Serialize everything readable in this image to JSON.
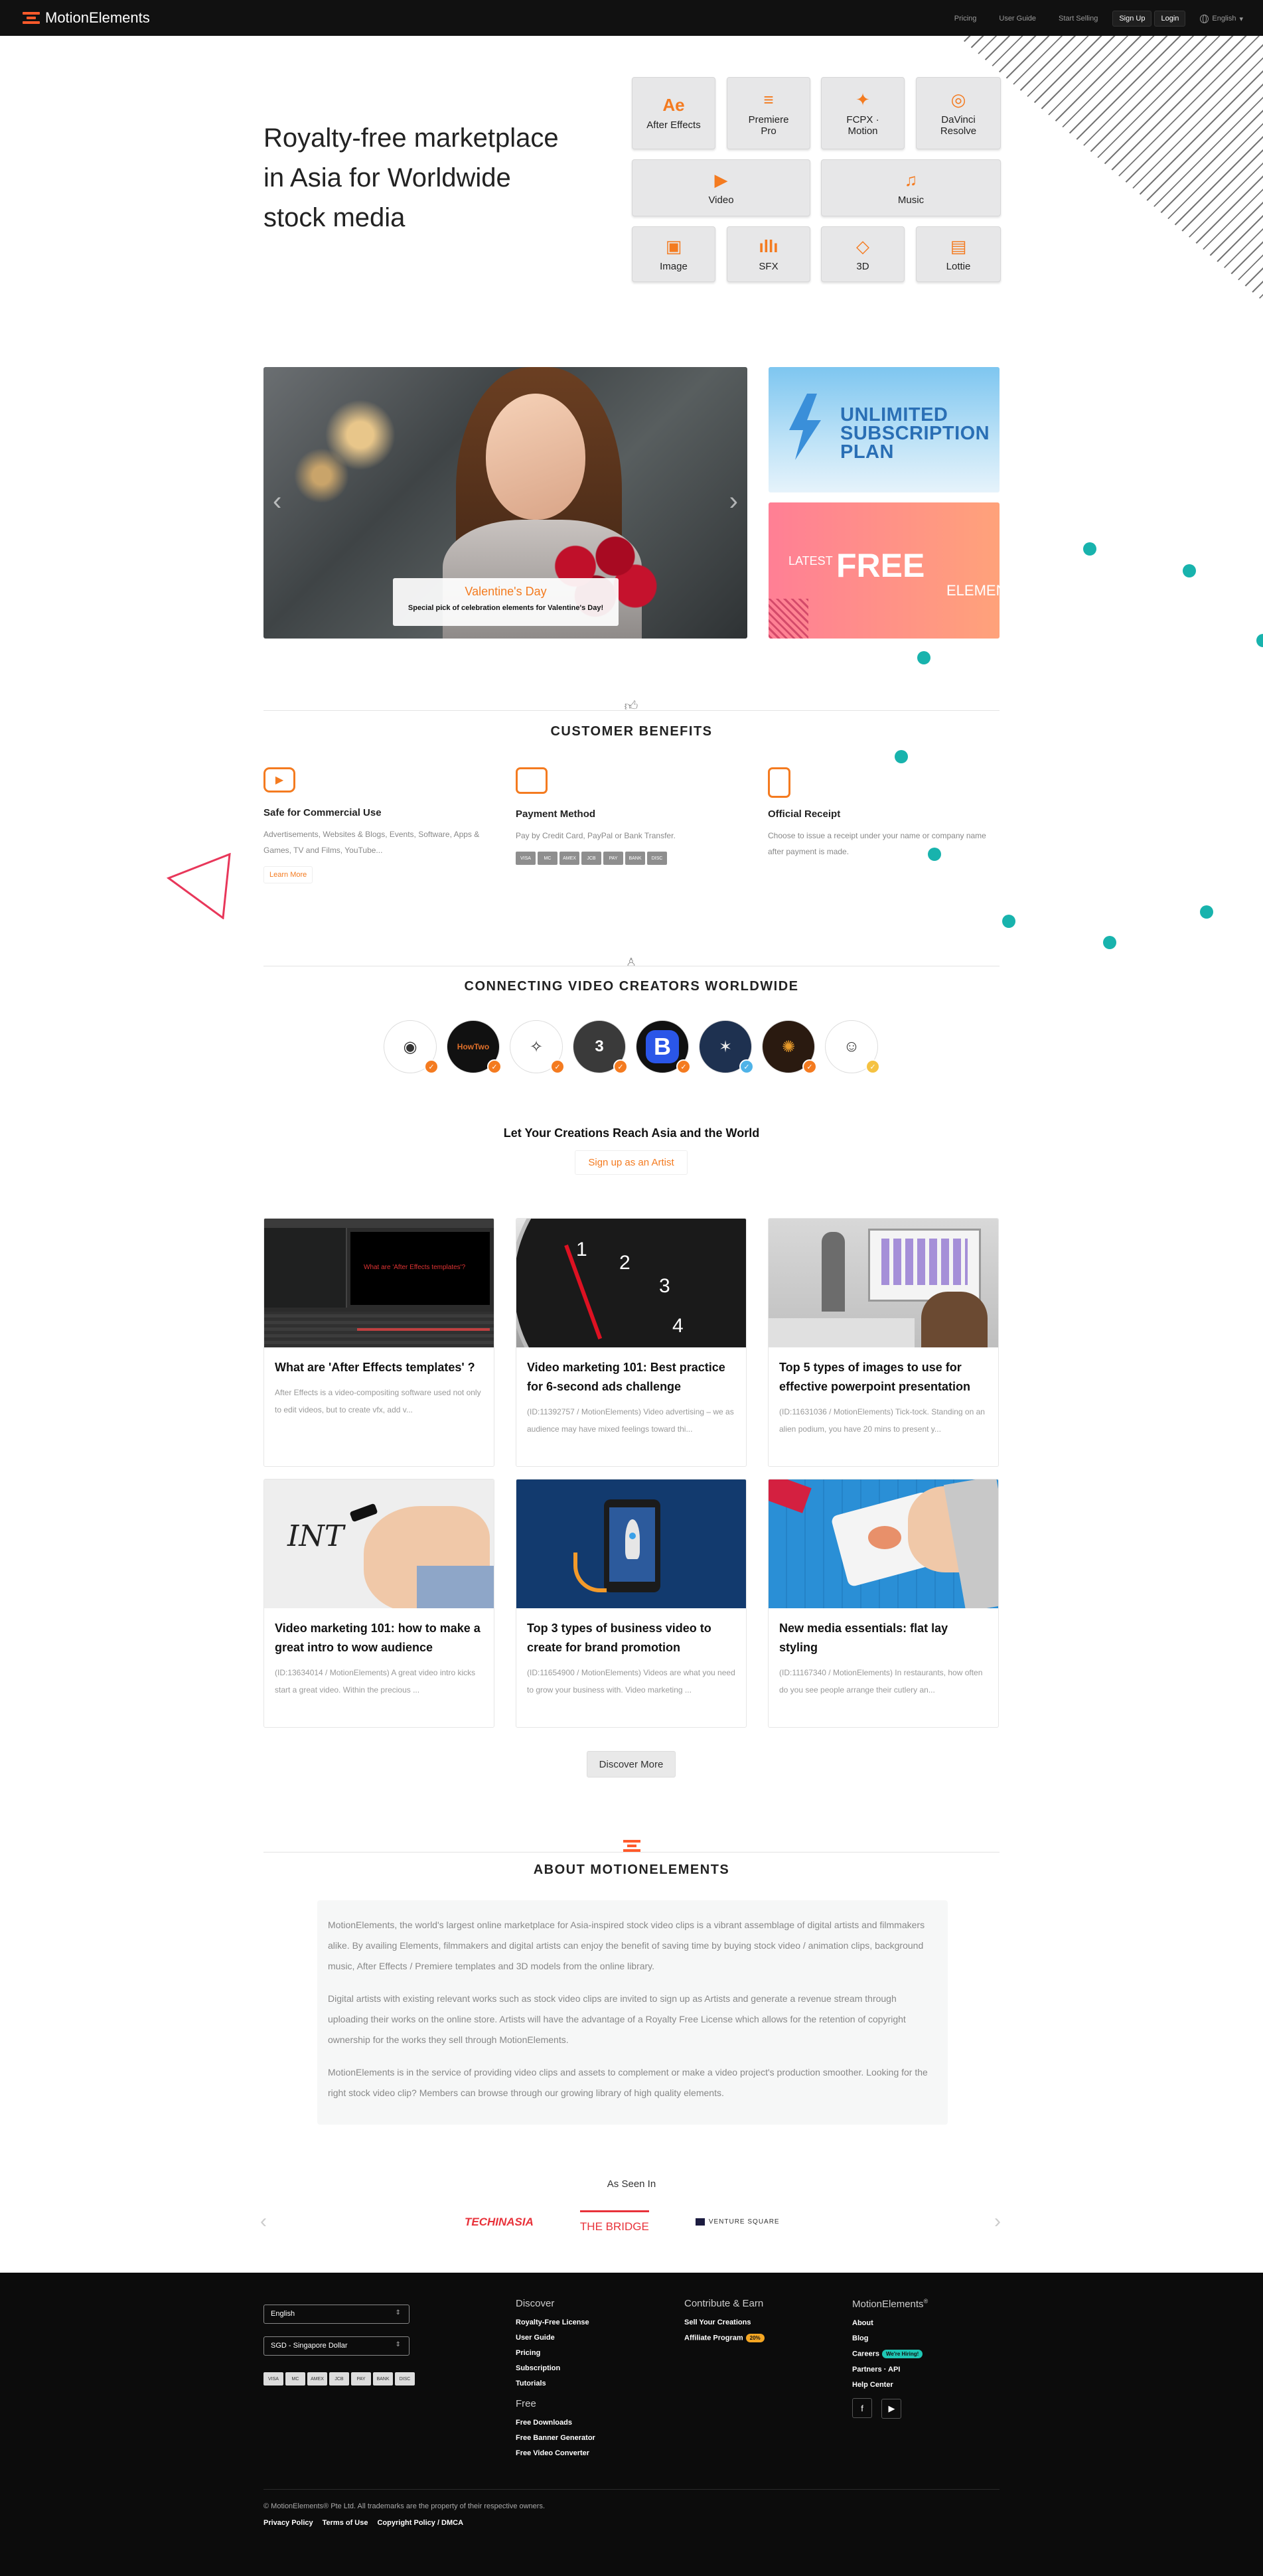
{
  "nav": {
    "brand": "MotionElements",
    "links": [
      "Pricing",
      "User Guide",
      "Start Selling"
    ],
    "signup": "Sign Up",
    "login": "Login",
    "language": "English"
  },
  "hero": {
    "title": "Royalty-free marketplace in Asia for Worldwide stock media",
    "categories": [
      {
        "label": "After Effects",
        "icon": "Ae"
      },
      {
        "label": "Premiere Pro",
        "icon": "≡"
      },
      {
        "label": "FCPX · Motion",
        "icon": "✦"
      },
      {
        "label": "DaVinci Resolve",
        "icon": "◎"
      },
      {
        "label": "Video",
        "icon": "▶"
      },
      {
        "label": "Music",
        "icon": "♫"
      },
      {
        "label": "Image",
        "icon": "▣"
      },
      {
        "label": "SFX",
        "icon": "ıllı"
      },
      {
        "label": "3D",
        "icon": "◇"
      },
      {
        "label": "Lottie",
        "icon": "▤"
      }
    ]
  },
  "slider": {
    "caption_title": "Valentine's Day",
    "caption_sub": "Special pick of celebration elements for Valentine's Day!",
    "prev": "‹",
    "next": "›"
  },
  "promos": {
    "subscription": "UNLIMITED SUBSCRIPTION PLAN",
    "latest": "LATEST",
    "free": "FREE",
    "elements": "ELEMENTS"
  },
  "benefits": {
    "title": "CUSTOMER BENEFITS",
    "items": [
      {
        "title": "Safe for Commercial Use",
        "desc": "Advertisements, Websites & Blogs, Events, Software, Apps & Games, TV and Films, YouTube...",
        "link": "Learn More"
      },
      {
        "title": "Payment Method",
        "desc": "Pay by Credit Card, PayPal or Bank Transfer.",
        "cards": [
          "VISA",
          "MC",
          "AMEX",
          "JCB",
          "PAY",
          "BANK",
          "DISC"
        ]
      },
      {
        "title": "Official Receipt",
        "desc": "Choose to issue a receipt under your name or company name after payment is made."
      }
    ]
  },
  "creators": {
    "title": "CONNECTING VIDEO CREATORS WORLDWIDE",
    "avatars": [
      "◉",
      "HowTwo",
      "✧",
      "3",
      "B",
      "✶",
      "✺",
      "☺"
    ],
    "reach": "Let Your Creations Reach Asia and the World",
    "signup": "Sign up as an Artist"
  },
  "posts": [
    {
      "title": "What are 'After Effects templates' ?",
      "desc": "After Effects is a video-compositing software used not only to edit videos, but to create vfx, add v...",
      "overlay": "What are 'After Effects templates'?"
    },
    {
      "title": "Video marketing 101: Best practice for 6-second ads challenge",
      "desc": "(ID:11392757 / MotionElements) Video advertising – we as audience may have mixed feelings toward thi..."
    },
    {
      "title": "Top 5 types of images to use for effective powerpoint presentation",
      "desc": "(ID:11631036 / MotionElements) Tick-tock. Standing on an alien podium, you have 20 mins to present y..."
    },
    {
      "title": "Video marketing 101: how to make a great intro to wow audience",
      "desc": "(ID:13634014 / MotionElements) A great video intro kicks start a great video. Within the precious ...",
      "overlay": "INT"
    },
    {
      "title": "Top 3 types of business video to create for brand promotion",
      "desc": "(ID:11654900 / MotionElements) Videos are what you need to grow your business with. Video marketing ..."
    },
    {
      "title": "New media essentials: flat lay styling",
      "desc": "(ID:11167340 / MotionElements) In restaurants, how often do you see people arrange their cutlery an..."
    }
  ],
  "discover": "Discover More",
  "about": {
    "title": "ABOUT MOTIONELEMENTS",
    "paragraphs": [
      "MotionElements, the world's largest online marketplace for Asia-inspired stock video clips is a vibrant assemblage of digital artists and filmmakers alike. By availing Elements, filmmakers and digital artists can enjoy the benefit of saving time by buying stock video / animation clips, background music, After Effects / Premiere templates and 3D models from the online library.",
      "Digital artists with existing relevant works such as stock video clips are invited to sign up as Artists and generate a revenue stream through uploading their works on the online store. Artists will have the advantage of a Royalty Free License which allows for the retention of copyright ownership for the works they sell through MotionElements.",
      "MotionElements is in the service of providing video clips and assets to complement or make a video project's production smoother. Looking for the right stock video clip? Members can browse through our growing library of high quality elements."
    ]
  },
  "seen": {
    "title": "As Seen In",
    "logos": [
      "TECHINASIA",
      "THE BRIDGE",
      "VENTURE SQUARE"
    ],
    "prev": "‹",
    "next": "›"
  },
  "footer": {
    "language": "English",
    "currency": "SGD - Singapore Dollar",
    "cards": [
      "VISA",
      "MC",
      "AMEX",
      "JCB",
      "PAY",
      "BANK",
      "DISC"
    ],
    "discover": {
      "heading": "Discover",
      "links": [
        "Royalty-Free License",
        "User Guide",
        "Pricing",
        "Subscription",
        "Tutorials"
      ]
    },
    "free": {
      "heading": "Free",
      "links": [
        "Free Downloads",
        "Free Banner Generator",
        "Free Video Converter"
      ]
    },
    "contribute": {
      "heading": "Contribute & Earn",
      "links": [
        "Sell Your Creations",
        "Affiliate Program"
      ],
      "badge": "20%"
    },
    "company": {
      "heading": "MotionElements",
      "reg": "®",
      "links": [
        "About",
        "Blog",
        "Careers",
        "Partners",
        "API",
        "Help Center"
      ],
      "careers_badge": "We're Hiring!"
    },
    "social": [
      "f",
      "▶"
    ],
    "copyright": "© MotionElements® Pte Ltd. All trademarks are the property of their respective owners.",
    "legal": [
      "Privacy Policy",
      "Terms of Use",
      "Copyright Policy / DMCA"
    ]
  },
  "colors": {
    "accent": "#f47b20",
    "teal": "#18b3ad",
    "dark": "#111111"
  }
}
